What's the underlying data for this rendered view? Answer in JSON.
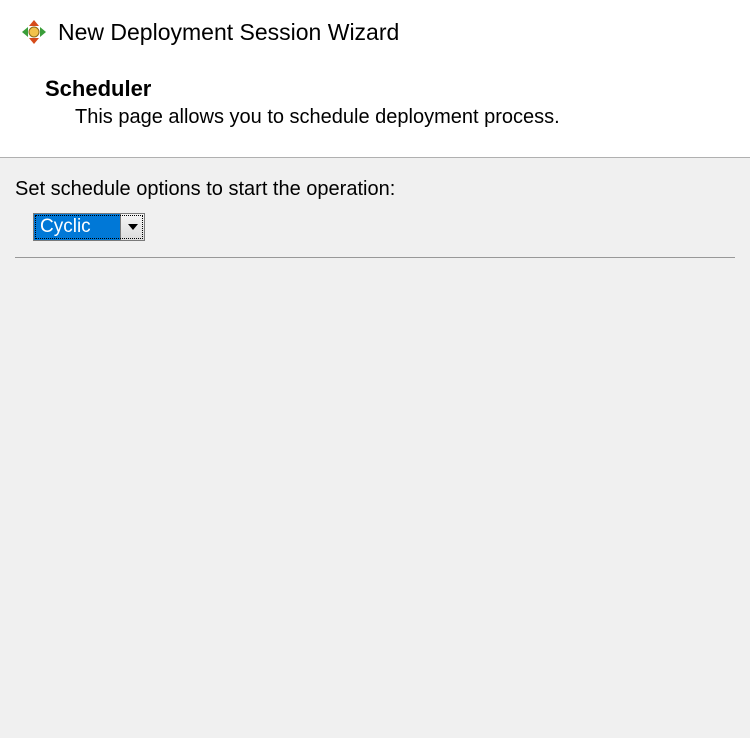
{
  "window": {
    "title": "New Deployment Session Wizard"
  },
  "header": {
    "heading": "Scheduler",
    "description": "This page allows you to schedule deployment process."
  },
  "content": {
    "option_label": "Set schedule options to start the operation:",
    "schedule_dropdown": {
      "value": "Cyclic"
    }
  },
  "icons": {
    "wizard": "wizard-icon"
  }
}
